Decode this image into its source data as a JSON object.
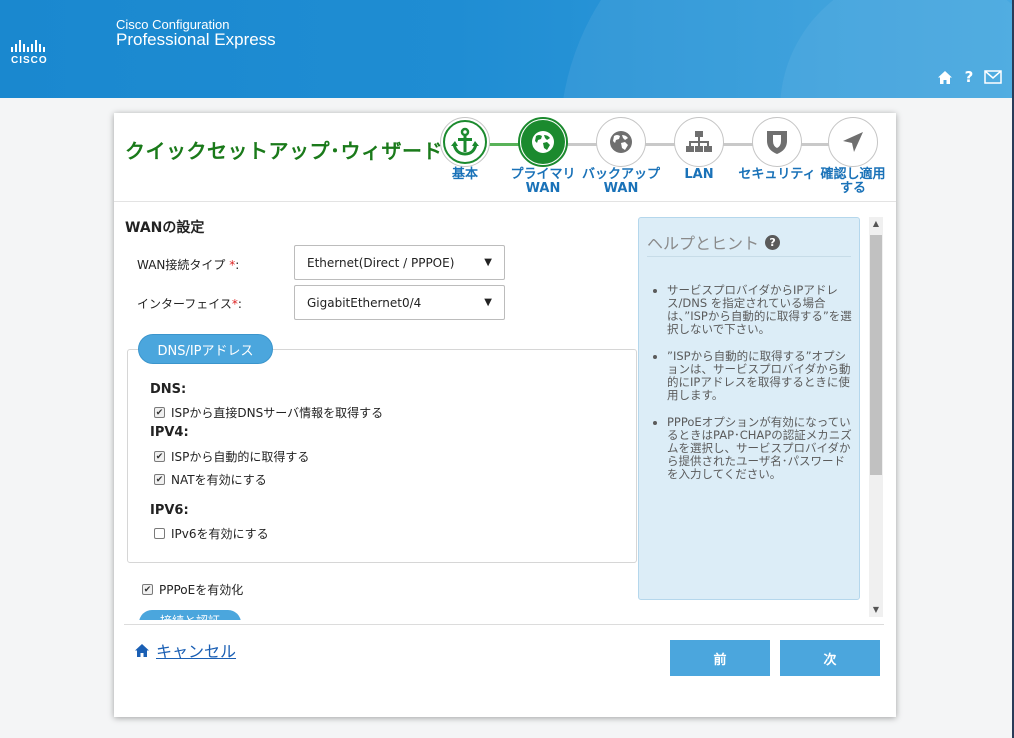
{
  "app": {
    "subtitle": "Cisco Configuration",
    "title": "Professional Express",
    "logo_text": "CISCO"
  },
  "header_icons": [
    "home-icon",
    "help-icon",
    "mail-icon"
  ],
  "wizard": {
    "title": "クイックセットアップ･ウィザード",
    "steps": [
      {
        "label1": "基本",
        "label2": "",
        "icon": "anchor-icon",
        "state": "done"
      },
      {
        "label1": "プライマリ",
        "label2": "WAN",
        "icon": "globe-icon",
        "state": "active"
      },
      {
        "label1": "バックアップ",
        "label2": "WAN",
        "icon": "globe-icon",
        "state": "pending"
      },
      {
        "label1": "LAN",
        "label2": "",
        "icon": "network-icon",
        "state": "pending"
      },
      {
        "label1": "セキュリティ",
        "label2": "",
        "icon": "shield-icon",
        "state": "pending"
      },
      {
        "label1": "確認し適用",
        "label2": "する",
        "icon": "arrow-icon",
        "state": "pending"
      }
    ]
  },
  "form": {
    "section_title": "WANの設定",
    "wan_type_label": "WAN接続タイプ",
    "wan_type_value": "Ethernet(Direct / PPPOE)",
    "interface_label": "インターフェイス",
    "interface_value": "GigabitEthernet0/4",
    "required_mark": "*",
    "colon": ":",
    "dns_tab": "DNS/IPアドレス",
    "dns_title": "DNS:",
    "dns_option": "ISPから直接DNSサーバ情報を取得する",
    "ipv4_title": "IPV4:",
    "ipv4_auto": "ISPから自動的に取得する",
    "nat": "NATを有効にする",
    "ipv6_title": "IPV6:",
    "ipv6_enable": "IPv6を有効にする",
    "pppoe": "PPPoEを有効化",
    "connection_tab": "接続と認証"
  },
  "checks": {
    "dns_option": true,
    "ipv4_auto": true,
    "nat": true,
    "ipv6_enable": false,
    "pppoe": true
  },
  "help": {
    "title": "ヘルプとヒント",
    "items": [
      "サービスプロバイダからIPアドレス/DNS を指定されている場合は、”ISPから自動的に取得する”を選択しないで下さい。",
      "”ISPから自動的に取得する”オプションは、サービスプロバイダから動的にIPアドレスを取得するときに使用します。",
      "PPPoEオプションが有効になっているときはPAP･CHAPの認証メカニズムを選択し、サービスプロバイダから提供されたユーザ名･パスワードを入力してください。"
    ]
  },
  "footer": {
    "cancel": "キャンセル",
    "prev": "前",
    "next": "次"
  },
  "colors": {
    "banner": "#1f8dd3",
    "accent": "#4ba6dd",
    "step_done": "#1b8a2e",
    "title_green": "#1a7a1a"
  }
}
